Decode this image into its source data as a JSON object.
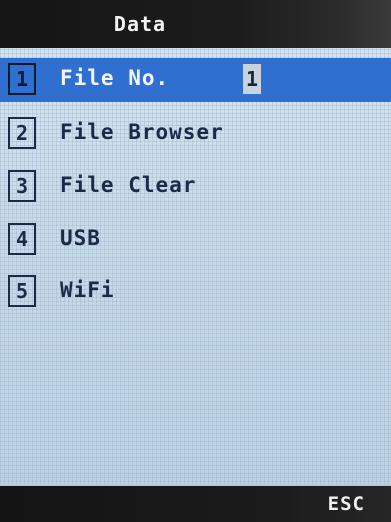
{
  "header": {
    "title": "Data"
  },
  "menu": {
    "items": [
      {
        "number": "1",
        "label": "File No.",
        "value": "1",
        "selected": true
      },
      {
        "number": "2",
        "label": "File Browser"
      },
      {
        "number": "3",
        "label": "File Clear"
      },
      {
        "number": "4",
        "label": "USB"
      },
      {
        "number": "5",
        "label": "WiFi"
      }
    ]
  },
  "footer": {
    "esc_label": "ESC"
  },
  "colors": {
    "selection": "#2f6fd0",
    "background": "#c9dcea",
    "bars": "#1a1a1a"
  }
}
